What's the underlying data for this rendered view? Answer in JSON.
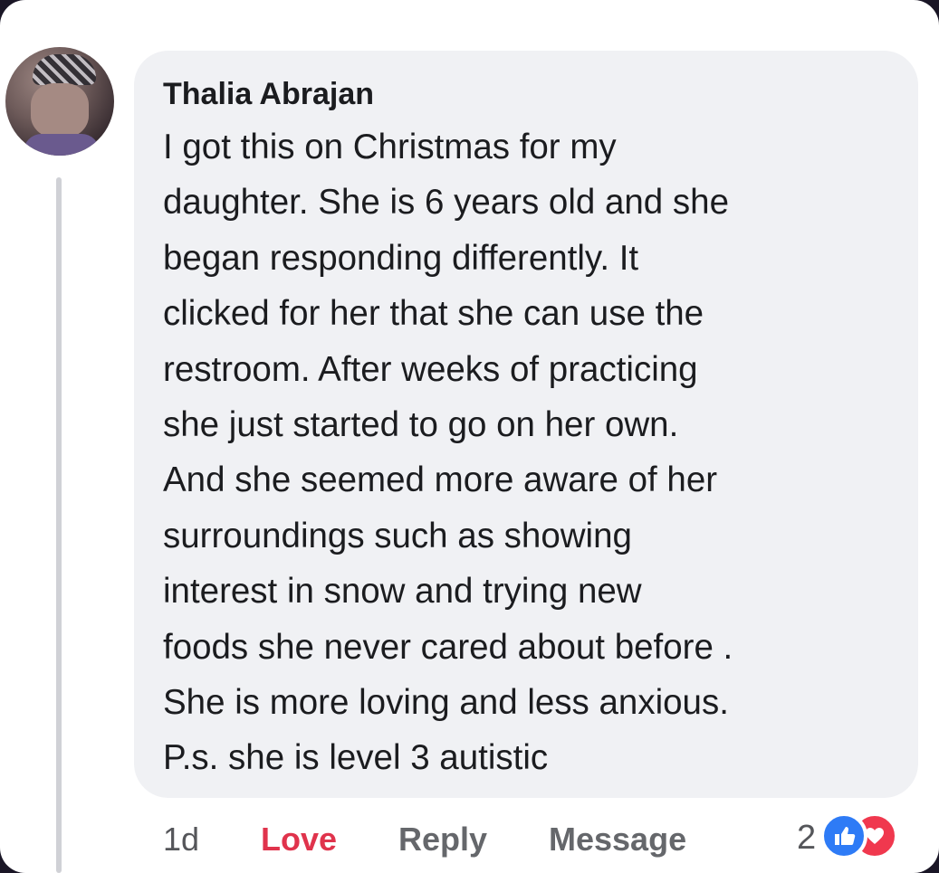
{
  "comment": {
    "author": "Thalia Abrajan",
    "lines": [
      "I got this on Christmas for my",
      "daughter. She is 6 years old and she",
      "began responding differently. It",
      "clicked for her that she can use the",
      "restroom. After weeks of practicing",
      "she just started to go on her own.",
      "And she seemed more aware of her",
      "surroundings such as showing",
      "interest in snow and trying new",
      "foods she never cared about before .",
      "She is more loving and less anxious.",
      "P.s. she is level 3 autistic"
    ]
  },
  "actions": {
    "time": "1d",
    "love": "Love",
    "reply": "Reply",
    "message": "Message"
  },
  "reactions": {
    "count": "2",
    "icons": [
      "like-icon",
      "love-icon"
    ]
  },
  "colors": {
    "love_active": "#e0334c",
    "like_blue": "#2e7bf6",
    "love_red": "#f0384e",
    "bubble_bg": "#f0f1f4"
  }
}
